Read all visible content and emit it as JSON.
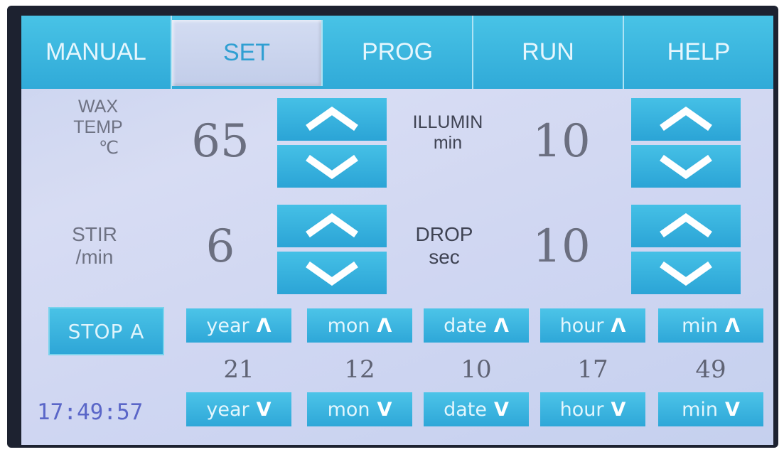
{
  "tabs": [
    {
      "label": "MANUAL"
    },
    {
      "label": "SET"
    },
    {
      "label": "PROG"
    },
    {
      "label": "RUN"
    },
    {
      "label": "HELP"
    }
  ],
  "active_tab": "SET",
  "settings": {
    "wax_temp": {
      "label_line1": "WAX",
      "label_line2": "TEMP",
      "unit": "℃",
      "value": "65"
    },
    "stir": {
      "label_line1": "STIR",
      "label_line2": "/min",
      "value": "6"
    },
    "illumin": {
      "label_line1": "ILLUMIN",
      "label_line2": "min",
      "value": "10"
    },
    "drop": {
      "label_line1": "DROP",
      "label_line2": "sec",
      "value": "10"
    }
  },
  "stop_button": {
    "label": "STOP A"
  },
  "time_setting": [
    {
      "up_label": "year",
      "down_label": "year",
      "value": "21"
    },
    {
      "up_label": "mon",
      "down_label": "mon",
      "value": "12"
    },
    {
      "up_label": "date",
      "down_label": "date",
      "value": "10"
    },
    {
      "up_label": "hour",
      "down_label": "hour",
      "value": "17"
    },
    {
      "up_label": "min",
      "down_label": "min",
      "value": "49"
    }
  ],
  "glyphs": {
    "up": "Λ",
    "down": "V"
  },
  "clock": "17:49:57",
  "colors": {
    "accent": "#2ea7d8",
    "screen_bg": "#cfd6f2",
    "clock_text": "#5a66c8"
  }
}
